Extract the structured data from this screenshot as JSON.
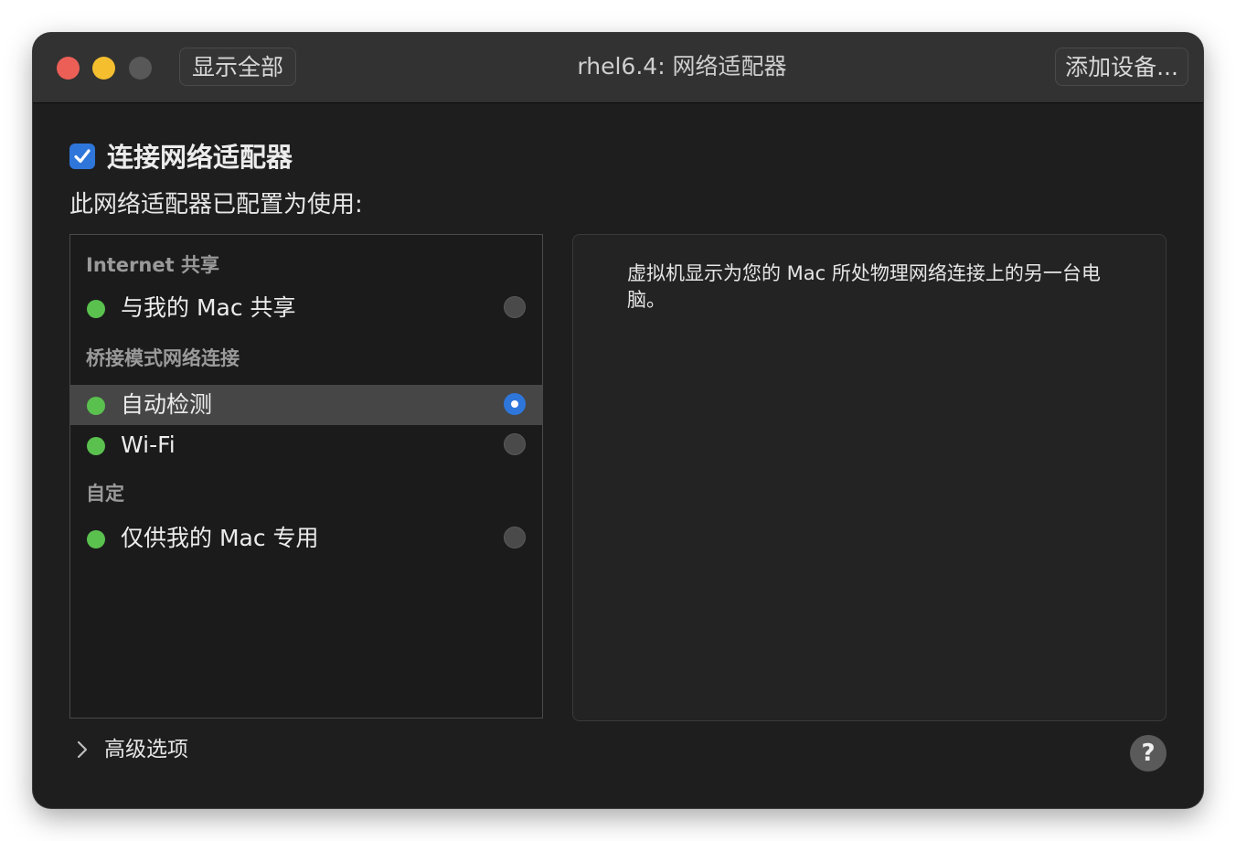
{
  "titlebar": {
    "show_all_label": "显示全部",
    "title": "rhel6.4: 网络适配器",
    "add_device_label": "添加设备..."
  },
  "connect": {
    "label": "连接网络适配器",
    "checked": true
  },
  "configured_label": "此网络适配器已配置为使用:",
  "list": {
    "sections": [
      {
        "header": "Internet 共享",
        "items": [
          {
            "label": "与我的 Mac 共享",
            "selected": false
          }
        ]
      },
      {
        "header": "桥接模式网络连接",
        "items": [
          {
            "label": "自动检测",
            "selected": true
          },
          {
            "label": "Wi-Fi",
            "selected": false
          }
        ]
      },
      {
        "header": "自定",
        "items": [
          {
            "label": "仅供我的 Mac 专用",
            "selected": false
          }
        ]
      }
    ]
  },
  "description": "虚拟机显示为您的 Mac 所处物理网络连接上的另一台电脑。",
  "advanced_label": "高级选项",
  "help_label": "?",
  "colors": {
    "accent": "#2f76db",
    "status_green": "#5ac14f",
    "window_bg": "#1e1e1e",
    "titlebar_bg": "#323232"
  },
  "icons": [
    "checkbox-checked-icon",
    "status-dot-icon",
    "radio-icon",
    "chevron-right-icon",
    "help-icon"
  ]
}
